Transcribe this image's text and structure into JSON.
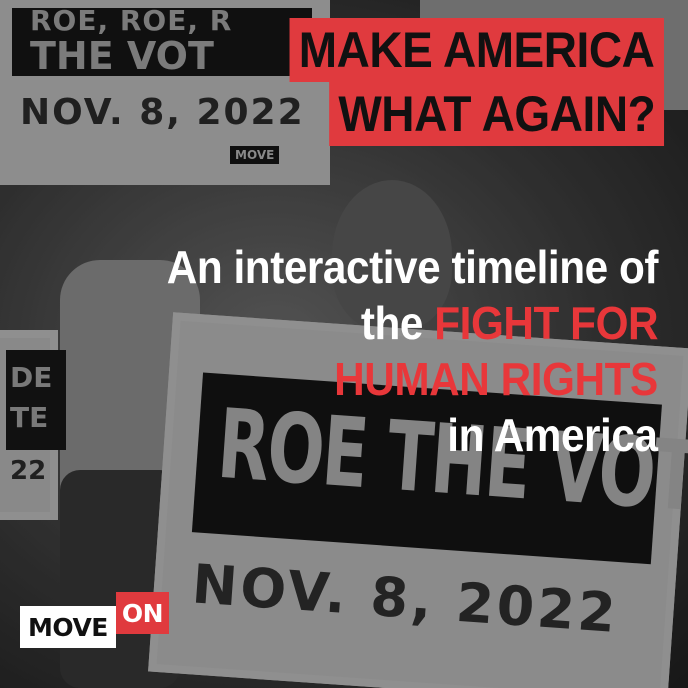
{
  "background_photo": {
    "sign_top_left": {
      "line1": "ROE, ROE, R",
      "line2": "THE VOT",
      "date": "NOV. 8, 2022",
      "tag": "MOVE"
    },
    "sign_main": {
      "line1": "ROE THE VOTE",
      "date": "NOV. 8, 2022"
    },
    "sign_left": {
      "line1": "DE",
      "line2": "TE",
      "date": "22"
    }
  },
  "headline": {
    "line1": "MAKE AMERICA",
    "line2": "WHAT AGAIN?"
  },
  "subheadline": {
    "line1": "An interactive timeline of",
    "line2_white": "the ",
    "line2_red": "FIGHT FOR",
    "line3_red": "HUMAN RIGHTS",
    "line4": "in America"
  },
  "logo": {
    "move": "MOVE",
    "on": "ON"
  },
  "colors": {
    "accent_red": "#e03a3e",
    "text_white": "#ffffff",
    "text_dark": "#111111"
  }
}
